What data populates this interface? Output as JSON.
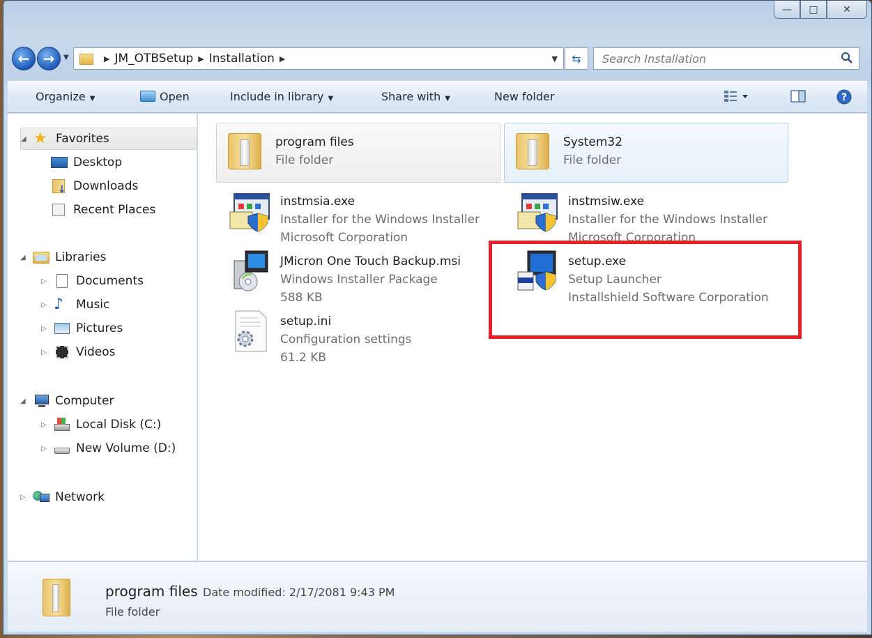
{
  "window": {
    "caption_buttons": {
      "minimize": "—",
      "maximize": "□",
      "close": "✕"
    }
  },
  "nav": {
    "back_icon": "back-arrow-icon",
    "forward_icon": "forward-arrow-icon",
    "breadcrumbs": [
      "JM_OTBSetup",
      "Installation"
    ],
    "search_placeholder": "Search Installation"
  },
  "toolbar": {
    "organize": "Organize",
    "open": "Open",
    "include_in_library": "Include in library",
    "share_with": "Share with",
    "new_folder": "New folder"
  },
  "sidebar": {
    "favorites": {
      "label": "Favorites",
      "items": [
        "Desktop",
        "Downloads",
        "Recent Places"
      ]
    },
    "libraries": {
      "label": "Libraries",
      "items": [
        "Documents",
        "Music",
        "Pictures",
        "Videos"
      ]
    },
    "computer": {
      "label": "Computer",
      "items": [
        "Local Disk (C:)",
        "New Volume (D:)"
      ]
    },
    "network": {
      "label": "Network"
    }
  },
  "files": [
    {
      "name": "program files",
      "line2": "File folder",
      "line3": "",
      "icon": "folder-icon"
    },
    {
      "name": "System32",
      "line2": "File folder",
      "line3": "",
      "icon": "folder-icon"
    },
    {
      "name": "instmsia.exe",
      "line2": "Installer for the Windows Installer",
      "line3": "Microsoft Corporation",
      "icon": "installer-exe-icon"
    },
    {
      "name": "instmsiw.exe",
      "line2": "Installer for the Windows Installer",
      "line3": "Microsoft Corporation",
      "icon": "installer-exe-icon"
    },
    {
      "name": "JMicron One Touch Backup.msi",
      "line2": "Windows Installer Package",
      "line3": "588 KB",
      "icon": "msi-package-icon"
    },
    {
      "name": "setup.exe",
      "line2": "Setup Launcher",
      "line3": "Installshield Software Corporation",
      "icon": "setup-launcher-icon"
    },
    {
      "name": "setup.ini",
      "line2": "Configuration settings",
      "line3": "61.2 KB",
      "icon": "config-file-icon"
    }
  ],
  "details": {
    "name": "program files",
    "meta": "Date modified: 2/17/2081 9:43 PM",
    "type": "File folder"
  },
  "colors": {
    "highlight": "#e8202a",
    "accent": "#1d5ab8"
  }
}
